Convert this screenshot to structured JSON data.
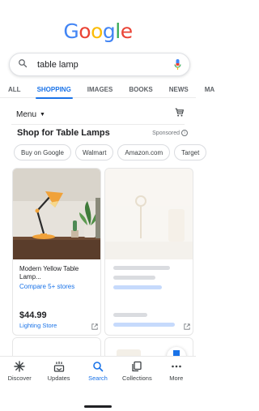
{
  "logo": {
    "letters": [
      "G",
      "o",
      "o",
      "g",
      "l",
      "e"
    ],
    "colors": [
      "#4285F4",
      "#EA4335",
      "#FBBC05",
      "#4285F4",
      "#34A853",
      "#EA4335"
    ]
  },
  "search": {
    "query": "table lamp"
  },
  "tabs": [
    {
      "label": "ALL",
      "active": false
    },
    {
      "label": "SHOPPING",
      "active": true
    },
    {
      "label": "IMAGES",
      "active": false
    },
    {
      "label": "BOOKS",
      "active": false
    },
    {
      "label": "NEWS",
      "active": false
    },
    {
      "label": "MA",
      "active": false
    }
  ],
  "filters": {
    "menu_label": "Menu"
  },
  "shop": {
    "title": "Shop for Table Lamps",
    "sponsored": "Sponsored"
  },
  "chips": [
    "Buy on Google",
    "Walmart",
    "Amazon.com",
    "Target"
  ],
  "product": {
    "name": "Modern Yellow Table Lamp...",
    "compare": "Compare 5+ stores",
    "price": "$44.99",
    "store": "Lighting Store"
  },
  "nav": {
    "items": [
      {
        "label": "Discover",
        "icon": "asterisk-icon",
        "active": false
      },
      {
        "label": "Updates",
        "icon": "updates-icon",
        "active": false
      },
      {
        "label": "Search",
        "icon": "search-icon",
        "active": true
      },
      {
        "label": "Collections",
        "icon": "collections-icon",
        "active": false
      },
      {
        "label": "More",
        "icon": "more-icon",
        "active": false
      }
    ]
  },
  "colors": {
    "accent": "#1a73e8",
    "text": "#202124",
    "muted": "#5f6368"
  }
}
